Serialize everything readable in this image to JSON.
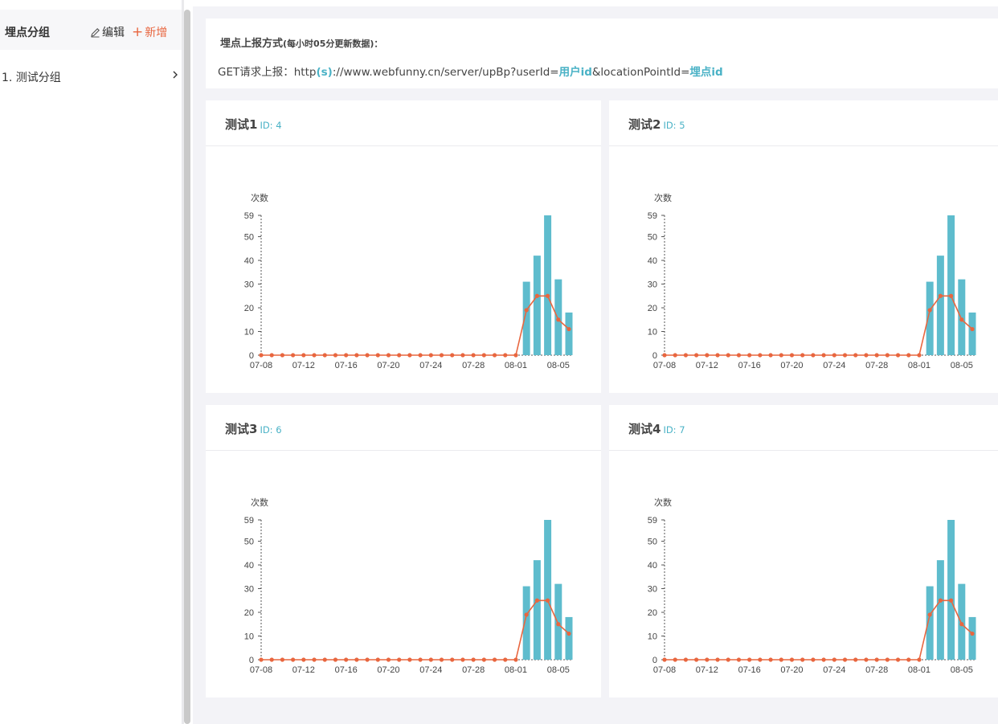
{
  "sidebar": {
    "title": "埋点分组",
    "edit_label": "编辑",
    "add_label": "新增",
    "items": [
      {
        "label": "1. 测试分组"
      }
    ]
  },
  "info": {
    "title": "埋点上报方式",
    "title_note": "(每小时05分更新数据)：",
    "url_prefix": "GET请求上报：http",
    "url_s": "(s)",
    "url_mid": "://www.webfunny.cn/server/upBp?userId=",
    "url_user": "用户id",
    "url_mid2": "&locationPointId=",
    "url_point": "埋点id"
  },
  "colors": {
    "bar": "#5ebccd",
    "line": "#e8663f",
    "accent": "#4ab2c6",
    "add": "#e8663f"
  },
  "cards": [
    {
      "name": "测试1",
      "id_label": "ID: 4"
    },
    {
      "name": "测试2",
      "id_label": "ID: 5"
    },
    {
      "name": "测试3",
      "id_label": "ID: 6"
    },
    {
      "name": "测试4",
      "id_label": "ID: 7"
    }
  ],
  "chart_data": [
    {
      "type": "bar",
      "ylabel": "次数",
      "yticks": [
        0,
        10,
        20,
        30,
        40,
        50,
        59
      ],
      "ylim": [
        0,
        59
      ],
      "xtick_labels": [
        "07-08",
        "07-12",
        "07-16",
        "07-20",
        "07-24",
        "07-28",
        "08-01",
        "08-05"
      ],
      "x": [
        "07-08",
        "07-09",
        "07-10",
        "07-11",
        "07-12",
        "07-13",
        "07-14",
        "07-15",
        "07-16",
        "07-17",
        "07-18",
        "07-19",
        "07-20",
        "07-21",
        "07-22",
        "07-23",
        "07-24",
        "07-25",
        "07-26",
        "07-27",
        "07-28",
        "07-29",
        "07-30",
        "07-31",
        "08-01",
        "08-02",
        "08-03",
        "08-04",
        "08-05",
        "08-06"
      ],
      "series": [
        {
          "type": "bar",
          "values": [
            0,
            0,
            0,
            0,
            0,
            0,
            0,
            0,
            0,
            0,
            0,
            0,
            0,
            0,
            0,
            0,
            0,
            0,
            0,
            0,
            0,
            0,
            0,
            0,
            0,
            31,
            42,
            59,
            32,
            18
          ]
        },
        {
          "type": "line",
          "values": [
            0,
            0,
            0,
            0,
            0,
            0,
            0,
            0,
            0,
            0,
            0,
            0,
            0,
            0,
            0,
            0,
            0,
            0,
            0,
            0,
            0,
            0,
            0,
            0,
            0,
            19,
            25,
            25,
            15,
            11
          ]
        }
      ]
    },
    {
      "type": "bar",
      "ylabel": "次数",
      "yticks": [
        0,
        10,
        20,
        30,
        40,
        50,
        59
      ],
      "ylim": [
        0,
        59
      ],
      "xtick_labels": [
        "07-08",
        "07-12",
        "07-16",
        "07-20",
        "07-24",
        "07-28",
        "08-01",
        "08-05"
      ],
      "x": [
        "07-08",
        "07-09",
        "07-10",
        "07-11",
        "07-12",
        "07-13",
        "07-14",
        "07-15",
        "07-16",
        "07-17",
        "07-18",
        "07-19",
        "07-20",
        "07-21",
        "07-22",
        "07-23",
        "07-24",
        "07-25",
        "07-26",
        "07-27",
        "07-28",
        "07-29",
        "07-30",
        "07-31",
        "08-01",
        "08-02",
        "08-03",
        "08-04",
        "08-05",
        "08-06"
      ],
      "series": [
        {
          "type": "bar",
          "values": [
            0,
            0,
            0,
            0,
            0,
            0,
            0,
            0,
            0,
            0,
            0,
            0,
            0,
            0,
            0,
            0,
            0,
            0,
            0,
            0,
            0,
            0,
            0,
            0,
            0,
            31,
            42,
            59,
            32,
            18
          ]
        },
        {
          "type": "line",
          "values": [
            0,
            0,
            0,
            0,
            0,
            0,
            0,
            0,
            0,
            0,
            0,
            0,
            0,
            0,
            0,
            0,
            0,
            0,
            0,
            0,
            0,
            0,
            0,
            0,
            0,
            19,
            25,
            25,
            15,
            11
          ]
        }
      ]
    },
    {
      "type": "bar",
      "ylabel": "次数",
      "yticks": [
        0,
        10,
        20,
        30,
        40,
        50,
        59
      ],
      "ylim": [
        0,
        59
      ],
      "xtick_labels": [
        "07-08",
        "07-12",
        "07-16",
        "07-20",
        "07-24",
        "07-28",
        "08-01",
        "08-05"
      ],
      "x": [
        "07-08",
        "07-09",
        "07-10",
        "07-11",
        "07-12",
        "07-13",
        "07-14",
        "07-15",
        "07-16",
        "07-17",
        "07-18",
        "07-19",
        "07-20",
        "07-21",
        "07-22",
        "07-23",
        "07-24",
        "07-25",
        "07-26",
        "07-27",
        "07-28",
        "07-29",
        "07-30",
        "07-31",
        "08-01",
        "08-02",
        "08-03",
        "08-04",
        "08-05",
        "08-06"
      ],
      "series": [
        {
          "type": "bar",
          "values": [
            0,
            0,
            0,
            0,
            0,
            0,
            0,
            0,
            0,
            0,
            0,
            0,
            0,
            0,
            0,
            0,
            0,
            0,
            0,
            0,
            0,
            0,
            0,
            0,
            0,
            31,
            42,
            59,
            32,
            18
          ]
        },
        {
          "type": "line",
          "values": [
            0,
            0,
            0,
            0,
            0,
            0,
            0,
            0,
            0,
            0,
            0,
            0,
            0,
            0,
            0,
            0,
            0,
            0,
            0,
            0,
            0,
            0,
            0,
            0,
            0,
            19,
            25,
            25,
            15,
            11
          ]
        }
      ]
    },
    {
      "type": "bar",
      "ylabel": "次数",
      "yticks": [
        0,
        10,
        20,
        30,
        40,
        50,
        59
      ],
      "ylim": [
        0,
        59
      ],
      "xtick_labels": [
        "07-08",
        "07-12",
        "07-16",
        "07-20",
        "07-24",
        "07-28",
        "08-01",
        "08-05"
      ],
      "x": [
        "07-08",
        "07-09",
        "07-10",
        "07-11",
        "07-12",
        "07-13",
        "07-14",
        "07-15",
        "07-16",
        "07-17",
        "07-18",
        "07-19",
        "07-20",
        "07-21",
        "07-22",
        "07-23",
        "07-24",
        "07-25",
        "07-26",
        "07-27",
        "07-28",
        "07-29",
        "07-30",
        "07-31",
        "08-01",
        "08-02",
        "08-03",
        "08-04",
        "08-05",
        "08-06"
      ],
      "series": [
        {
          "type": "bar",
          "values": [
            0,
            0,
            0,
            0,
            0,
            0,
            0,
            0,
            0,
            0,
            0,
            0,
            0,
            0,
            0,
            0,
            0,
            0,
            0,
            0,
            0,
            0,
            0,
            0,
            0,
            31,
            42,
            59,
            32,
            18
          ]
        },
        {
          "type": "line",
          "values": [
            0,
            0,
            0,
            0,
            0,
            0,
            0,
            0,
            0,
            0,
            0,
            0,
            0,
            0,
            0,
            0,
            0,
            0,
            0,
            0,
            0,
            0,
            0,
            0,
            0,
            19,
            25,
            25,
            15,
            11
          ]
        }
      ]
    }
  ]
}
